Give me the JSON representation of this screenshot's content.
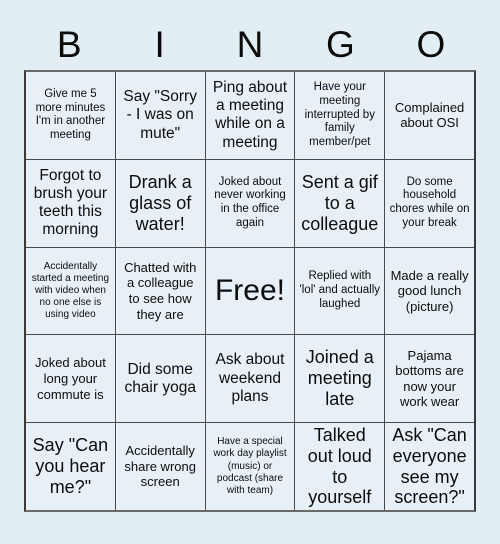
{
  "card": {
    "title": "BINGO",
    "background_color": "#e3eef4",
    "cell_color": "#e6f0f6",
    "line_color": "#4a4a4a",
    "text_color": "#0d0d0d"
  },
  "header": {
    "letters": [
      "B",
      "I",
      "N",
      "G",
      "O"
    ]
  },
  "grid": {
    "columns": 5,
    "rows": 5,
    "cells": [
      {
        "text": "Give me 5 more minutes I'm in another meeting",
        "size": "sz-sm",
        "free": false
      },
      {
        "text": "Say \"Sorry - I was on mute\"",
        "size": "sz-lg",
        "free": false
      },
      {
        "text": "Ping about a meeting while on a meeting",
        "size": "sz-lg",
        "free": false
      },
      {
        "text": "Have your meeting interrupted by family member/pet",
        "size": "sz-sm",
        "free": false
      },
      {
        "text": "Complained about OSI",
        "size": "sz-md",
        "free": false
      },
      {
        "text": "Forgot to brush your teeth this morning",
        "size": "sz-lg",
        "free": false
      },
      {
        "text": "Drank a glass of water!",
        "size": "sz-xl",
        "free": false
      },
      {
        "text": "Joked about never working in the office again",
        "size": "sz-sm",
        "free": false
      },
      {
        "text": "Sent a gif to a colleague",
        "size": "sz-xl",
        "free": false
      },
      {
        "text": "Do some household chores while on your break",
        "size": "sz-sm",
        "free": false
      },
      {
        "text": "Accidentally started a meeting with video when no one else is using video",
        "size": "sz-xs",
        "free": false
      },
      {
        "text": "Chatted with a colleague to see how they are",
        "size": "sz-md",
        "free": false
      },
      {
        "text": "Free!",
        "size": "sz-free",
        "free": true
      },
      {
        "text": "Replied with 'lol' and actually laughed",
        "size": "sz-sm",
        "free": false
      },
      {
        "text": "Made a really good lunch (picture)",
        "size": "sz-md",
        "free": false
      },
      {
        "text": "Joked about long your commute is",
        "size": "sz-md",
        "free": false
      },
      {
        "text": "Did some chair yoga",
        "size": "sz-lg",
        "free": false
      },
      {
        "text": "Ask about weekend plans",
        "size": "sz-lg",
        "free": false
      },
      {
        "text": "Joined a meeting late",
        "size": "sz-xl",
        "free": false
      },
      {
        "text": "Pajama bottoms are now your work wear",
        "size": "sz-md",
        "free": false
      },
      {
        "text": "Say \"Can you hear me?\"",
        "size": "sz-xl",
        "free": false
      },
      {
        "text": "Accidentally share wrong screen",
        "size": "sz-md",
        "free": false
      },
      {
        "text": "Have a special work day playlist (music) or podcast (share with team)",
        "size": "sz-xs",
        "free": false
      },
      {
        "text": "Talked out loud to yourself",
        "size": "sz-xl",
        "free": false
      },
      {
        "text": "Ask \"Can everyone see my screen?\"",
        "size": "sz-xl",
        "free": false
      }
    ]
  }
}
